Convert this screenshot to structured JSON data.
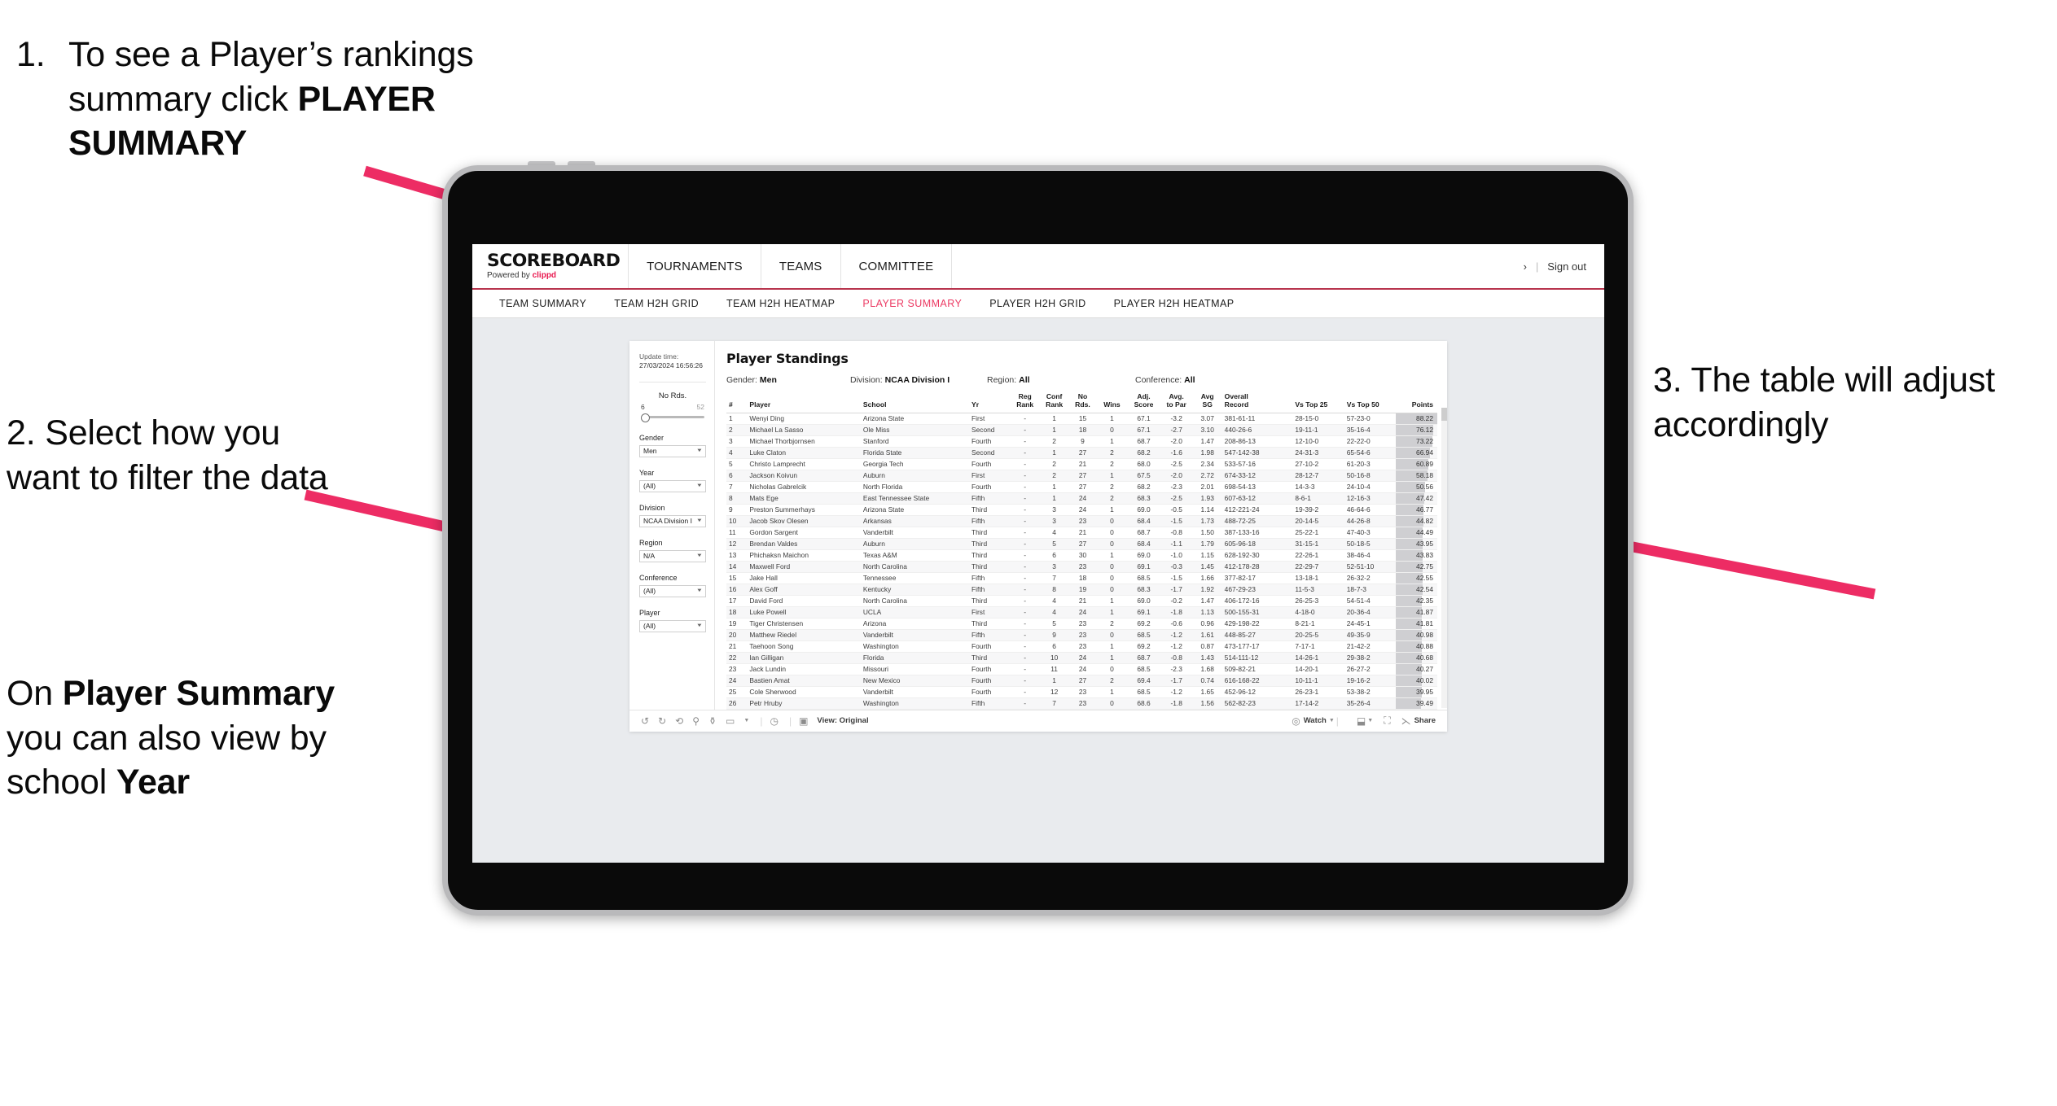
{
  "annotations": {
    "a1_number": "1.",
    "a1_line1": "To see a Player’s rankings",
    "a1_line2_pre": "summary click ",
    "a1_line2_bold": "PLAYER",
    "a1_line3_bold": "SUMMARY",
    "a2": "2. Select how you want to filter the data",
    "a2b_pre": "On ",
    "a2b_bold1": "Player Summary",
    "a2b_mid": " you can also view by school ",
    "a2b_bold2": "Year",
    "a3": "3. The table will adjust accordingly"
  },
  "colors": {
    "accent_pink": "#ec3a63",
    "arrow_pink": "#ed2c64",
    "brand_red": "#e8174e",
    "header_underline": "#b8344d"
  },
  "app": {
    "brand_logo": "SCOREBOARD",
    "brand_powered_pre": "Powered by ",
    "brand_powered_name": "clippd",
    "top_nav": [
      "TOURNAMENTS",
      "TEAMS",
      "COMMITTEE"
    ],
    "top_right": {
      "chevron": "›",
      "divider": "|",
      "sign_out": "Sign out"
    },
    "sub_tabs": [
      {
        "label": "TEAM SUMMARY",
        "active": false
      },
      {
        "label": "TEAM H2H GRID",
        "active": false
      },
      {
        "label": "TEAM H2H HEATMAP",
        "active": false
      },
      {
        "label": "PLAYER SUMMARY",
        "active": true
      },
      {
        "label": "PLAYER H2H GRID",
        "active": false
      },
      {
        "label": "PLAYER H2H HEATMAP",
        "active": false
      }
    ]
  },
  "sidebar": {
    "update_label": "Update time:",
    "update_value": "27/03/2024 16:56:26",
    "slider": {
      "title": "No Rds.",
      "min": "6",
      "max": "52"
    },
    "filters": [
      {
        "label": "Gender",
        "value": "Men"
      },
      {
        "label": "Year",
        "value": "(All)"
      },
      {
        "label": "Division",
        "value": "NCAA Division I"
      },
      {
        "label": "Region",
        "value": "N/A"
      },
      {
        "label": "Conference",
        "value": "(All)"
      },
      {
        "label": "Player",
        "value": "(All)"
      }
    ]
  },
  "dashboard": {
    "title": "Player Standings",
    "meta": [
      {
        "label": "Gender: ",
        "value": "Men"
      },
      {
        "label": "Division: ",
        "value": "NCAA Division I"
      },
      {
        "label": "Region: ",
        "value": "All"
      },
      {
        "label": "Conference: ",
        "value": "All"
      }
    ],
    "columns": [
      {
        "l1": "#",
        "l2": ""
      },
      {
        "l1": "Player",
        "l2": ""
      },
      {
        "l1": "School",
        "l2": ""
      },
      {
        "l1": "Yr",
        "l2": ""
      },
      {
        "l1": "Reg",
        "l2": "Rank"
      },
      {
        "l1": "Conf",
        "l2": "Rank"
      },
      {
        "l1": "No",
        "l2": "Rds."
      },
      {
        "l1": "Wins",
        "l2": ""
      },
      {
        "l1": "Adj.",
        "l2": "Score"
      },
      {
        "l1": "Avg.",
        "l2": "to Par"
      },
      {
        "l1": "Avg",
        "l2": "SG"
      },
      {
        "l1": "Overall",
        "l2": "Record"
      },
      {
        "l1": "Vs Top 25",
        "l2": ""
      },
      {
        "l1": "Vs Top 50",
        "l2": ""
      },
      {
        "l1": "Points",
        "l2": ""
      }
    ],
    "rows": [
      [
        "1",
        "Wenyi Ding",
        "Arizona State",
        "First",
        "-",
        "1",
        "15",
        "1",
        "67.1",
        "-3.2",
        "3.07",
        "381-61-11",
        "28-15-0",
        "57-23-0",
        "88.22"
      ],
      [
        "2",
        "Michael La Sasso",
        "Ole Miss",
        "Second",
        "-",
        "1",
        "18",
        "0",
        "67.1",
        "-2.7",
        "3.10",
        "440-26-6",
        "19-11-1",
        "35-16-4",
        "76.12"
      ],
      [
        "3",
        "Michael Thorbjornsen",
        "Stanford",
        "Fourth",
        "-",
        "2",
        "9",
        "1",
        "68.7",
        "-2.0",
        "1.47",
        "208-86-13",
        "12-10-0",
        "22-22-0",
        "73.22"
      ],
      [
        "4",
        "Luke Claton",
        "Florida State",
        "Second",
        "-",
        "1",
        "27",
        "2",
        "68.2",
        "-1.6",
        "1.98",
        "547-142-38",
        "24-31-3",
        "65-54-6",
        "66.94"
      ],
      [
        "5",
        "Christo Lamprecht",
        "Georgia Tech",
        "Fourth",
        "-",
        "2",
        "21",
        "2",
        "68.0",
        "-2.5",
        "2.34",
        "533-57-16",
        "27-10-2",
        "61-20-3",
        "60.89"
      ],
      [
        "6",
        "Jackson Koivun",
        "Auburn",
        "First",
        "-",
        "2",
        "27",
        "1",
        "67.5",
        "-2.0",
        "2.72",
        "674-33-12",
        "28-12-7",
        "50-16-8",
        "58.18"
      ],
      [
        "7",
        "Nicholas Gabrelcik",
        "North Florida",
        "Fourth",
        "-",
        "1",
        "27",
        "2",
        "68.2",
        "-2.3",
        "2.01",
        "698-54-13",
        "14-3-3",
        "24-10-4",
        "50.56"
      ],
      [
        "8",
        "Mats Ege",
        "East Tennessee State",
        "Fifth",
        "-",
        "1",
        "24",
        "2",
        "68.3",
        "-2.5",
        "1.93",
        "607-63-12",
        "8-6-1",
        "12-16-3",
        "47.42"
      ],
      [
        "9",
        "Preston Summerhays",
        "Arizona State",
        "Third",
        "-",
        "3",
        "24",
        "1",
        "69.0",
        "-0.5",
        "1.14",
        "412-221-24",
        "19-39-2",
        "46-64-6",
        "46.77"
      ],
      [
        "10",
        "Jacob Skov Olesen",
        "Arkansas",
        "Fifth",
        "-",
        "3",
        "23",
        "0",
        "68.4",
        "-1.5",
        "1.73",
        "488-72-25",
        "20-14-5",
        "44-26-8",
        "44.82"
      ],
      [
        "11",
        "Gordon Sargent",
        "Vanderbilt",
        "Third",
        "-",
        "4",
        "21",
        "0",
        "68.7",
        "-0.8",
        "1.50",
        "387-133-16",
        "25-22-1",
        "47-40-3",
        "44.49"
      ],
      [
        "12",
        "Brendan Valdes",
        "Auburn",
        "Third",
        "-",
        "5",
        "27",
        "0",
        "68.4",
        "-1.1",
        "1.79",
        "605-96-18",
        "31-15-1",
        "50-18-5",
        "43.95"
      ],
      [
        "13",
        "Phichaksn Maichon",
        "Texas A&M",
        "Third",
        "-",
        "6",
        "30",
        "1",
        "69.0",
        "-1.0",
        "1.15",
        "628-192-30",
        "22-26-1",
        "38-46-4",
        "43.83"
      ],
      [
        "14",
        "Maxwell Ford",
        "North Carolina",
        "Third",
        "-",
        "3",
        "23",
        "0",
        "69.1",
        "-0.3",
        "1.45",
        "412-178-28",
        "22-29-7",
        "52-51-10",
        "42.75"
      ],
      [
        "15",
        "Jake Hall",
        "Tennessee",
        "Fifth",
        "-",
        "7",
        "18",
        "0",
        "68.5",
        "-1.5",
        "1.66",
        "377-82-17",
        "13-18-1",
        "26-32-2",
        "42.55"
      ],
      [
        "16",
        "Alex Goff",
        "Kentucky",
        "Fifth",
        "-",
        "8",
        "19",
        "0",
        "68.3",
        "-1.7",
        "1.92",
        "467-29-23",
        "11-5-3",
        "18-7-3",
        "42.54"
      ],
      [
        "17",
        "David Ford",
        "North Carolina",
        "Third",
        "-",
        "4",
        "21",
        "1",
        "69.0",
        "-0.2",
        "1.47",
        "406-172-16",
        "26-25-3",
        "54-51-4",
        "42.35"
      ],
      [
        "18",
        "Luke Powell",
        "UCLA",
        "First",
        "-",
        "4",
        "24",
        "1",
        "69.1",
        "-1.8",
        "1.13",
        "500-155-31",
        "4-18-0",
        "20-36-4",
        "41.87"
      ],
      [
        "19",
        "Tiger Christensen",
        "Arizona",
        "Third",
        "-",
        "5",
        "23",
        "2",
        "69.2",
        "-0.6",
        "0.96",
        "429-198-22",
        "8-21-1",
        "24-45-1",
        "41.81"
      ],
      [
        "20",
        "Matthew Riedel",
        "Vanderbilt",
        "Fifth",
        "-",
        "9",
        "23",
        "0",
        "68.5",
        "-1.2",
        "1.61",
        "448-85-27",
        "20-25-5",
        "49-35-9",
        "40.98"
      ],
      [
        "21",
        "Taehoon Song",
        "Washington",
        "Fourth",
        "-",
        "6",
        "23",
        "1",
        "69.2",
        "-1.2",
        "0.87",
        "473-177-17",
        "7-17-1",
        "21-42-2",
        "40.88"
      ],
      [
        "22",
        "Ian Gilligan",
        "Florida",
        "Third",
        "-",
        "10",
        "24",
        "1",
        "68.7",
        "-0.8",
        "1.43",
        "514-111-12",
        "14-26-1",
        "29-38-2",
        "40.68"
      ],
      [
        "23",
        "Jack Lundin",
        "Missouri",
        "Fourth",
        "-",
        "11",
        "24",
        "0",
        "68.5",
        "-2.3",
        "1.68",
        "509-82-21",
        "14-20-1",
        "26-27-2",
        "40.27"
      ],
      [
        "24",
        "Bastien Amat",
        "New Mexico",
        "Fourth",
        "-",
        "1",
        "27",
        "2",
        "69.4",
        "-1.7",
        "0.74",
        "616-168-22",
        "10-11-1",
        "19-16-2",
        "40.02"
      ],
      [
        "25",
        "Cole Sherwood",
        "Vanderbilt",
        "Fourth",
        "-",
        "12",
        "23",
        "1",
        "68.5",
        "-1.2",
        "1.65",
        "452-96-12",
        "26-23-1",
        "53-38-2",
        "39.95"
      ],
      [
        "26",
        "Petr Hruby",
        "Washington",
        "Fifth",
        "-",
        "7",
        "23",
        "0",
        "68.6",
        "-1.8",
        "1.56",
        "562-82-23",
        "17-14-2",
        "35-26-4",
        "39.49"
      ]
    ]
  },
  "toolbar": {
    "view_label": "View: Original",
    "watch_label": "Watch",
    "share_label": "Share"
  }
}
